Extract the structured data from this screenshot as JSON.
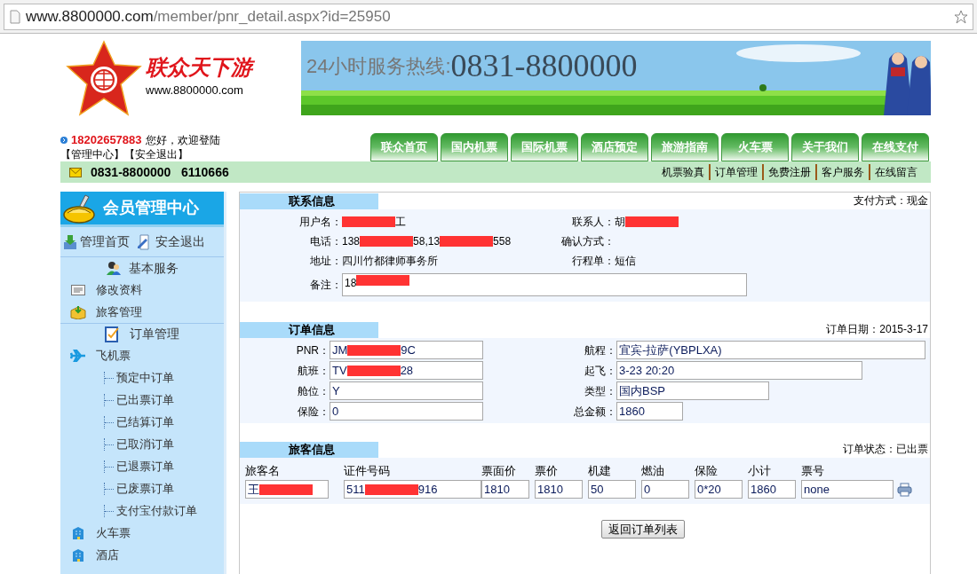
{
  "address_bar": {
    "host": "www.8800000.com",
    "path": "/member/pnr_detail.aspx?id=25950"
  },
  "logo": {
    "name": "联众天下游",
    "url": "www.8800000.com"
  },
  "banner": {
    "hotline_label": "24小时服务热线:",
    "hotline_number": "0831-8800000"
  },
  "welcome": {
    "phone": "18202657883",
    "greeting": "您好，欢迎登陆",
    "links": [
      "【管理中心】",
      "【安全退出】"
    ]
  },
  "nav_tabs": [
    "联众首页",
    "国内机票",
    "国际机票",
    "酒店预定",
    "旅游指南",
    "火车票",
    "关于我们",
    "在线支付"
  ],
  "info_bar": {
    "phones": "0831-8800000   6110666",
    "links": [
      "机票验真",
      "订单管理",
      "免费注册",
      "客户服务",
      "在线留言"
    ]
  },
  "sidebar": {
    "title": "会员管理中心",
    "top_links": [
      {
        "label": "管理首页",
        "kind": "home"
      },
      {
        "label": "安全退出",
        "kind": "logout"
      }
    ],
    "sections": [
      {
        "heading": "基本服务",
        "kind": "users",
        "items": [
          {
            "label": "修改资料",
            "kind": "card"
          },
          {
            "label": "旅客管理",
            "kind": "box"
          }
        ]
      },
      {
        "heading": "订单管理",
        "kind": "clipboard",
        "items": [
          {
            "label": "飞机票",
            "kind": "plane",
            "children": [
              {
                "label": "预定中订单"
              },
              {
                "label": "已出票订单"
              },
              {
                "label": "已结算订单"
              },
              {
                "label": "已取消订单"
              },
              {
                "label": "已退票订单"
              },
              {
                "label": "已废票订单"
              },
              {
                "label": "支付宝付款订单"
              }
            ]
          },
          {
            "label": "火车票",
            "kind": "building"
          },
          {
            "label": "酒店",
            "kind": "building"
          }
        ]
      }
    ]
  },
  "contact": {
    "title": "联系信息",
    "note": "支付方式：现金",
    "rows": [
      [
        {
          "label": "用户名：",
          "value": [
            {
              "kind": "redaction"
            },
            {
              "kind": "text",
              "text": "工"
            }
          ]
        },
        {
          "label": "联系人：",
          "value": [
            {
              "kind": "text",
              "text": "胡"
            },
            {
              "kind": "redaction"
            }
          ]
        }
      ],
      [
        {
          "label": "电话：",
          "value": [
            {
              "kind": "text",
              "text": "138"
            },
            {
              "kind": "redaction"
            },
            {
              "kind": "text",
              "text": "58,13"
            },
            {
              "kind": "redaction"
            },
            {
              "kind": "text",
              "text": "558"
            }
          ]
        },
        {
          "label": "确认方式："
        }
      ],
      [
        {
          "label": "地址：",
          "value": [
            {
              "kind": "text",
              "text": "四川竹都律师事务所"
            }
          ]
        },
        {
          "label": "行程单：",
          "value": [
            {
              "kind": "text",
              "text": "短信"
            }
          ]
        }
      ]
    ],
    "remark": {
      "label": "备注：",
      "value": [
        {
          "kind": "text",
          "text": "18"
        },
        {
          "kind": "redaction"
        }
      ]
    }
  },
  "order": {
    "title": "订单信息",
    "note": "订单日期：2015-3-17",
    "left": [
      {
        "label": "PNR：",
        "value": [
          {
            "kind": "text",
            "text": "JM"
          },
          {
            "kind": "redaction"
          },
          {
            "kind": "text",
            "text": "9C"
          }
        ]
      },
      {
        "label": "航班：",
        "value": [
          {
            "kind": "text",
            "text": "TV"
          },
          {
            "kind": "redaction"
          },
          {
            "kind": "text",
            "text": "28"
          }
        ]
      },
      {
        "label": "舱位：",
        "value": [
          {
            "kind": "text",
            "text": "Y"
          }
        ]
      },
      {
        "label": "保险：",
        "value": [
          {
            "kind": "text",
            "text": "0"
          }
        ]
      }
    ],
    "right": [
      {
        "label": "航程：",
        "value": [
          {
            "kind": "text",
            "text": "宜宾-拉萨(YBPLXA)"
          }
        ]
      },
      {
        "label": "起飞：",
        "value": [
          {
            "kind": "text",
            "text": "3-23 20:20"
          }
        ]
      },
      {
        "label": "类型：",
        "value": [
          {
            "kind": "text",
            "text": "国内BSP"
          }
        ]
      },
      {
        "label": "总金额：",
        "value": [
          {
            "kind": "text",
            "text": "1860"
          }
        ]
      }
    ]
  },
  "passengers": {
    "title": "旅客信息",
    "note": "订单状态：已出票",
    "columns": [
      "旅客名",
      "证件号码",
      "票面价",
      "票价",
      "机建",
      "燃油",
      "保险",
      "小计",
      "票号"
    ],
    "rows": [
      [
        [
          {
            "kind": "text",
            "text": "王"
          },
          {
            "kind": "redaction"
          }
        ],
        [
          {
            "kind": "text",
            "text": "511"
          },
          {
            "kind": "redaction"
          },
          {
            "kind": "text",
            "text": "916"
          }
        ],
        [
          {
            "kind": "text",
            "text": "1810"
          }
        ],
        [
          {
            "kind": "text",
            "text": "1810"
          }
        ],
        [
          {
            "kind": "text",
            "text": "50"
          }
        ],
        [
          {
            "kind": "text",
            "text": "0"
          }
        ],
        [
          {
            "kind": "text",
            "text": "0*20"
          }
        ],
        [
          {
            "kind": "text",
            "text": "1860"
          }
        ],
        [
          {
            "kind": "text",
            "text": "none"
          }
        ]
      ]
    ]
  },
  "back_button": "返回订单列表"
}
